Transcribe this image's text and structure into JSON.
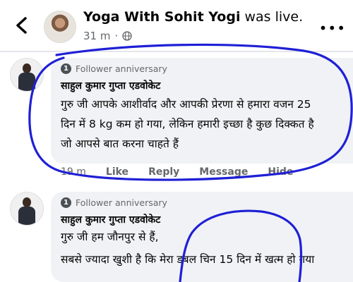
{
  "header": {
    "page_name": "Yoga With Sohit Yogi",
    "status": "was live.",
    "time": "31 m",
    "separator": "·"
  },
  "comments": [
    {
      "badge": "Follower anniversary",
      "author": "साहुल कुमार गुप्ता एडवोकेट",
      "lines": [
        "गुरु जी आपके आशीर्वाद और आपकी प्रेरणा से हमारा वजन 25",
        "दिन में 8 kg कम हो गया, लेकिन हमारी इच्छा है कुछ दिक्कत है",
        "जो आपसे बात करना चाहते हैं"
      ],
      "actions": {
        "time": "19 m",
        "like": "Like",
        "reply": "Reply",
        "message": "Message",
        "hide": "Hide"
      }
    },
    {
      "badge": "Follower anniversary",
      "author": "साहुल कुमार गुप्ता एडवोकेट",
      "lines": [
        "गुरु जी हम जौनपुर से हैं,",
        "सबसे ज्यादा खुशी है कि मेरा डबल चिन 15 दिन में खत्म हो गया"
      ]
    }
  ],
  "icons": {
    "back": "back-arrow-icon",
    "globe": "globe-icon",
    "more": "more-options-icon",
    "badge": "follower-badge-icon"
  },
  "colors": {
    "annotation": "#1f1fd6",
    "bubble": "#f0f2f5",
    "muted": "#65676b"
  }
}
